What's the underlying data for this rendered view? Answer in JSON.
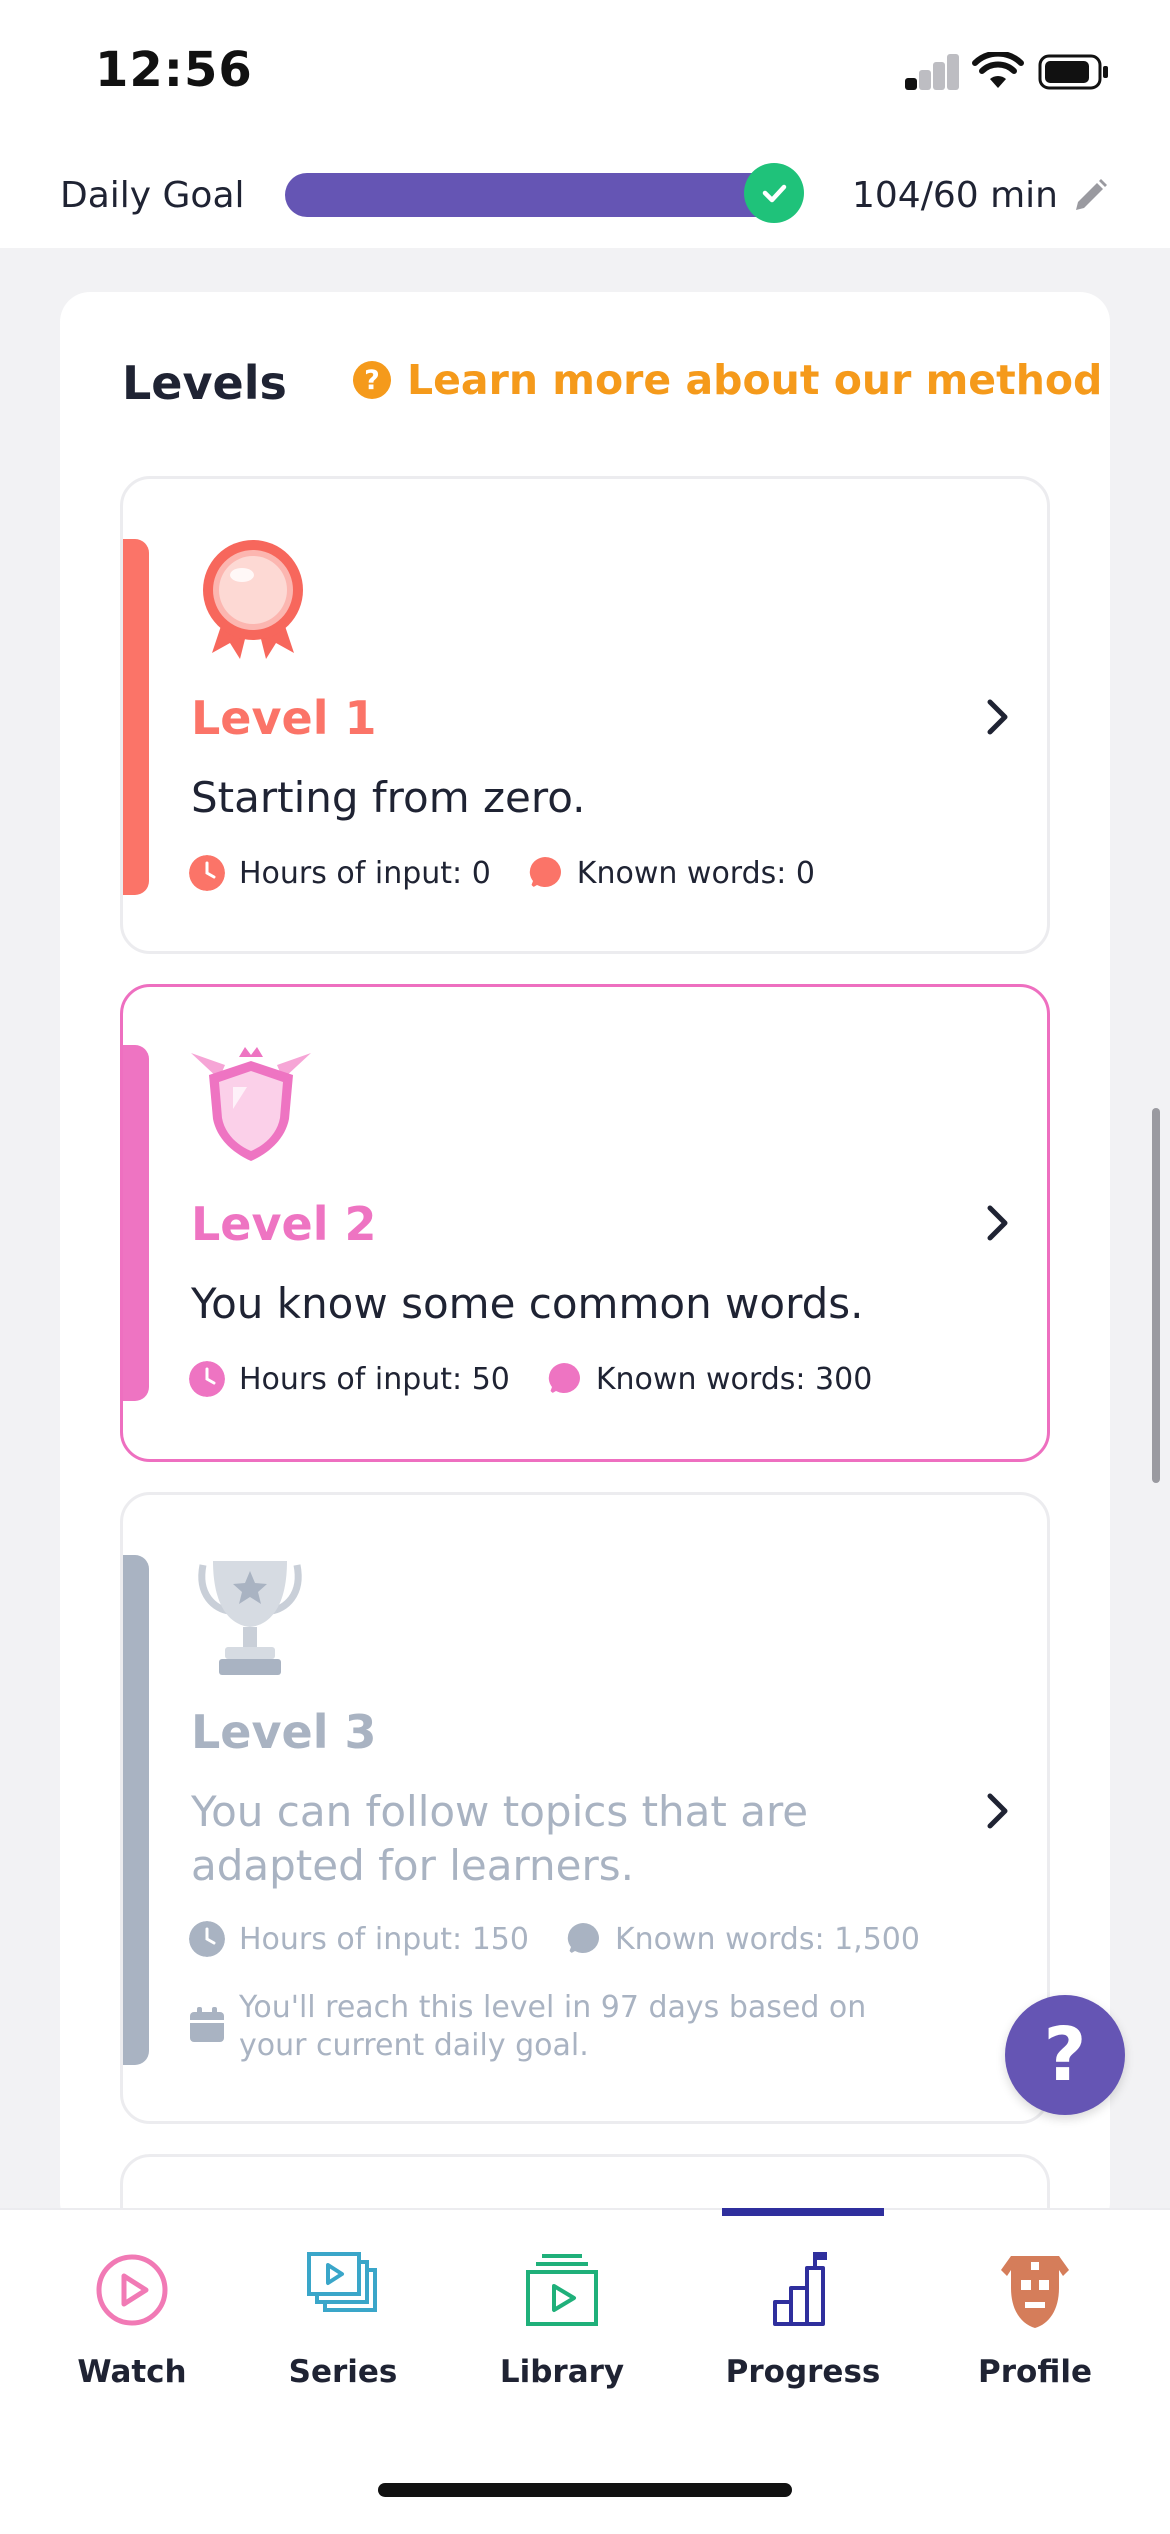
{
  "status_bar": {
    "time": "12:56"
  },
  "daily_goal": {
    "label": "Daily Goal",
    "value": "104/60 min",
    "progress": 1.0
  },
  "levels_section": {
    "title": "Levels",
    "learn_more": "Learn more about our method"
  },
  "levels": [
    {
      "name": "Level 1",
      "description": "Starting from zero.",
      "hours": "Hours of input: 0",
      "words": "Known words: 0",
      "color": "#fb7468"
    },
    {
      "name": "Level 2",
      "description": "You know some common words.",
      "hours": "Hours of input: 50",
      "words": "Known words: 300",
      "color": "#ee74c2"
    },
    {
      "name": "Level 3",
      "description": "You can follow topics that are adapted for learners.",
      "hours": "Hours of input: 150",
      "words": "Known words: 1,500",
      "note": "You'll reach this level in 97 days based on your current daily goal.",
      "color": "#a9b3c2"
    }
  ],
  "help_button": {
    "label": "?"
  },
  "tab_bar": {
    "tabs": [
      {
        "label": "Watch",
        "icon": "play-circle-icon",
        "color": "#f17ab5"
      },
      {
        "label": "Series",
        "icon": "series-stack-icon",
        "color": "#3aa6c9"
      },
      {
        "label": "Library",
        "icon": "library-icon",
        "color": "#1fb07a"
      },
      {
        "label": "Progress",
        "icon": "progress-chart-icon",
        "color": "#2f2f9d"
      },
      {
        "label": "Profile",
        "icon": "profile-mask-icon",
        "color": "#d57d5a"
      }
    ],
    "active": "Progress"
  }
}
